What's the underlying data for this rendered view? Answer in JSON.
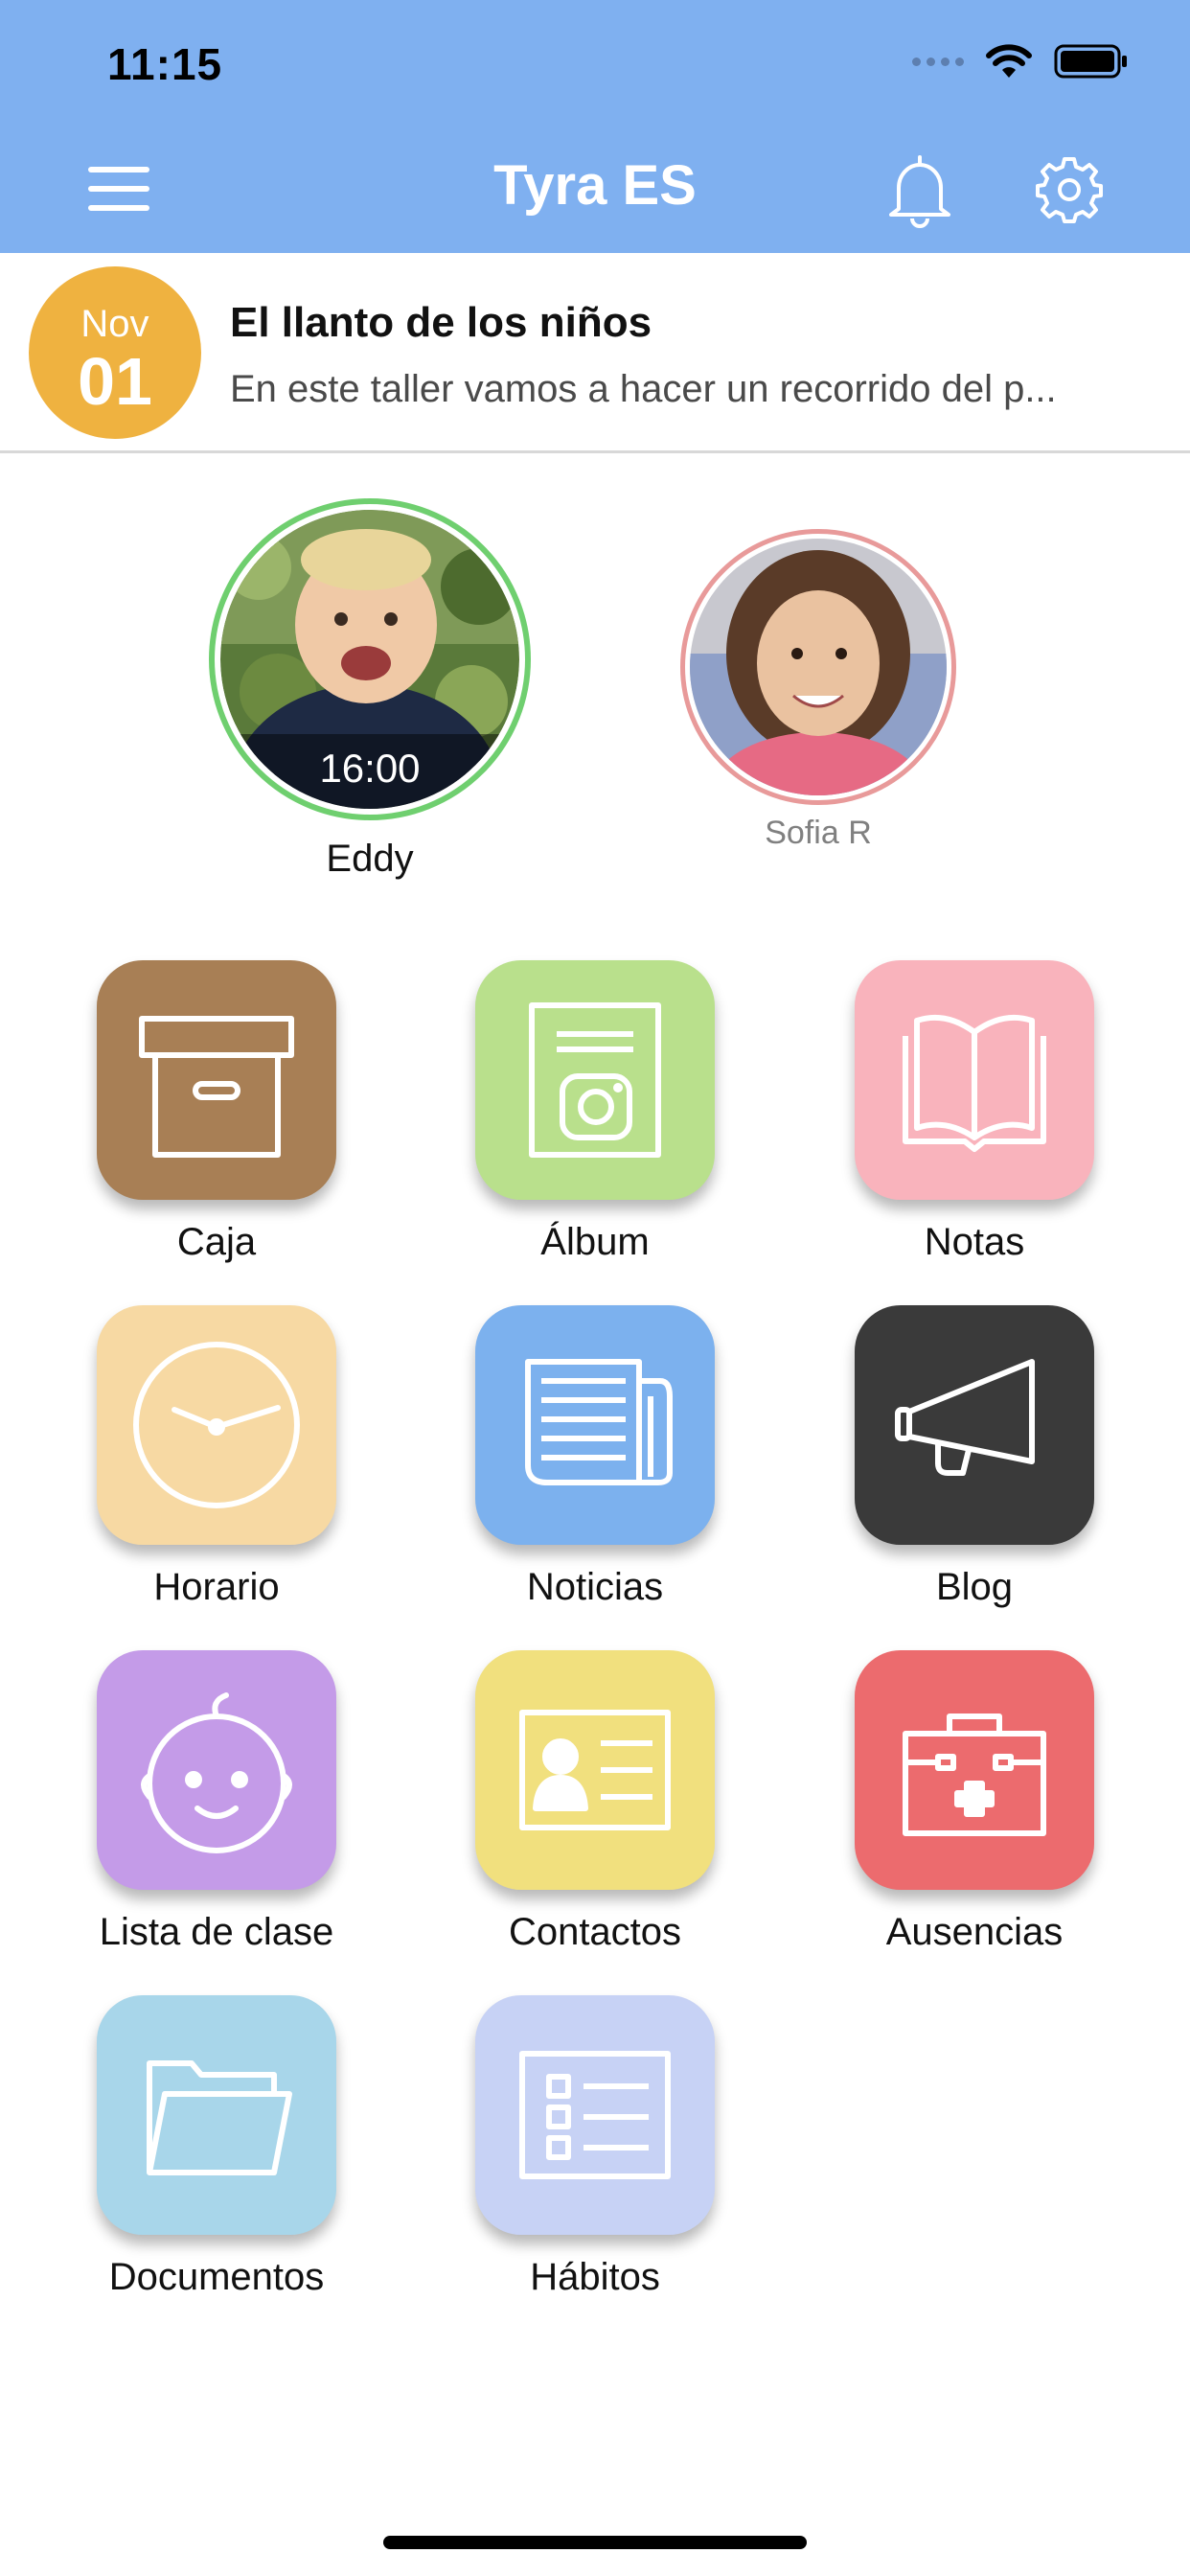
{
  "status_bar": {
    "time": "11:15"
  },
  "nav": {
    "title": "Tyra ES"
  },
  "event": {
    "month": "Nov",
    "day": "01",
    "title": "El llanto de los niños",
    "description": "En este taller vamos a hacer un recorrido del p..."
  },
  "children": [
    {
      "name": "Eddy",
      "time": "16:00",
      "ring_color": "#6fcf6f"
    },
    {
      "name": "Sofia R",
      "ring_color": "#e89a9a"
    }
  ],
  "apps": [
    {
      "label": "Caja",
      "color": "#a87f55",
      "icon": "archive-box-icon"
    },
    {
      "label": "Álbum",
      "color": "#b9e08c",
      "icon": "photo-album-icon"
    },
    {
      "label": "Notas",
      "color": "#f9b3bc",
      "icon": "open-book-icon"
    },
    {
      "label": "Horario",
      "color": "#f7d9a3",
      "icon": "clock-icon"
    },
    {
      "label": "Noticias",
      "color": "#7cb1ee",
      "icon": "newspaper-icon"
    },
    {
      "label": "Blog",
      "color": "#3a3a3a",
      "icon": "megaphone-icon"
    },
    {
      "label": "Lista de clase",
      "color": "#c49be8",
      "icon": "baby-face-icon"
    },
    {
      "label": "Contactos",
      "color": "#f1e07e",
      "icon": "contact-card-icon"
    },
    {
      "label": "Ausencias",
      "color": "#ec6b6e",
      "icon": "first-aid-kit-icon"
    },
    {
      "label": "Documentos",
      "color": "#a8d6ea",
      "icon": "folder-icon"
    },
    {
      "label": "Hábitos",
      "color": "#c7d2f5",
      "icon": "checklist-icon"
    }
  ]
}
